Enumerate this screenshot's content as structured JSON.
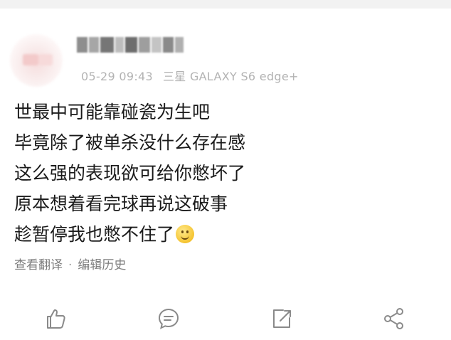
{
  "post": {
    "meta": {
      "timestamp": "05-29 09:43",
      "device": "三星 GALAXY S6 edge+"
    },
    "content_lines": [
      "世最中可能靠碰瓷为生吧",
      "毕竟除了被单杀没什么存在感",
      "这么强的表现欲可给你憋坏了",
      "原本想着看完球再说这破事",
      "趁暂停我也憋不住了"
    ],
    "emoji": "smile-emoji",
    "links": {
      "translate": "查看翻译",
      "separator": "·",
      "edit_history": "编辑历史"
    }
  },
  "actions": [
    {
      "icon": "thumbs-up-icon"
    },
    {
      "icon": "comment-icon"
    },
    {
      "icon": "repost-icon"
    },
    {
      "icon": "share-icon"
    }
  ],
  "colors": {
    "text": "#1a1a1a",
    "meta": "#b3b3b3",
    "links": "#7d7d7d",
    "icons": "#8a8a8a",
    "background": "#f2f2f2"
  }
}
